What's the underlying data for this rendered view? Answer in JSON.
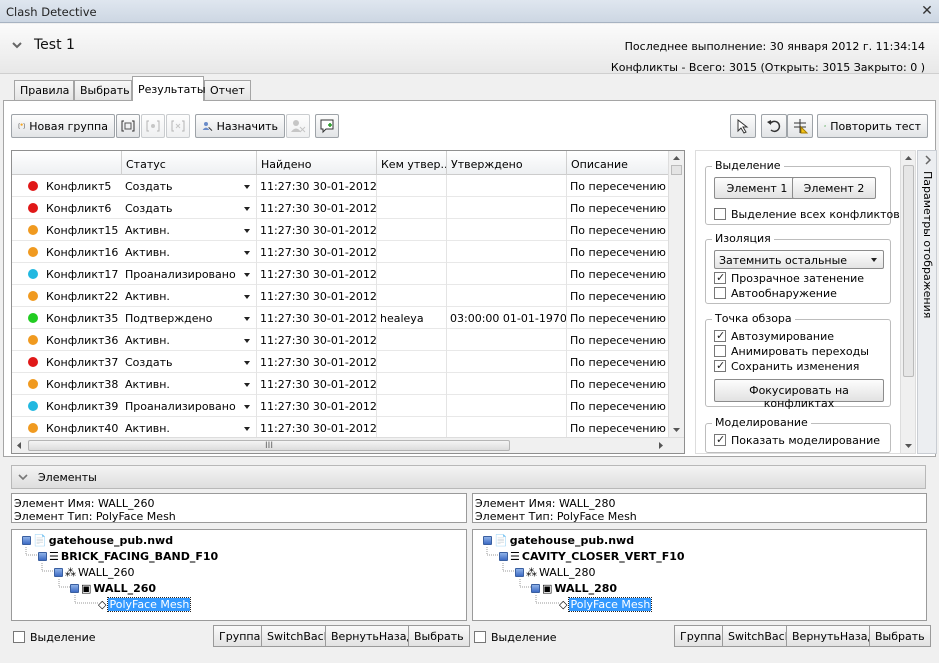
{
  "window": {
    "title": "Clash Detective"
  },
  "test": {
    "name": "Test 1",
    "last_run": "Последнее выполнение:  30 января 2012 г. 11:34:14",
    "summary": "Конфликты -  Всего:  3015  (Открыть:  3015  Закрыто:  0 )"
  },
  "tabs": [
    {
      "label": "Правила"
    },
    {
      "label": "Выбрать"
    },
    {
      "label": "Результаты"
    },
    {
      "label": "Отчет"
    }
  ],
  "toolbar": {
    "new_group": "Новая группа",
    "assign": "Назначить",
    "rerun": "Повторить тест"
  },
  "grid": {
    "columns": [
      "Статус",
      "Найдено",
      "Кем утвер...",
      "Утверждено",
      "Описание"
    ],
    "rows": [
      {
        "name": "Конфликт5",
        "color": "#e01818",
        "status": "Создать",
        "found": "11:27:30 30-01-2012",
        "by": "",
        "approved": "",
        "desc": "По пересечению"
      },
      {
        "name": "Конфликт6",
        "color": "#e01818",
        "status": "Создать",
        "found": "11:27:30 30-01-2012",
        "by": "",
        "approved": "",
        "desc": "По пересечению"
      },
      {
        "name": "Конфликт15",
        "color": "#f09a20",
        "status": "Активн.",
        "found": "11:27:30 30-01-2012",
        "by": "",
        "approved": "",
        "desc": "По пересечению"
      },
      {
        "name": "Конфликт16",
        "color": "#f09a20",
        "status": "Активн.",
        "found": "11:27:30 30-01-2012",
        "by": "",
        "approved": "",
        "desc": "По пересечению"
      },
      {
        "name": "Конфликт17",
        "color": "#22b8e0",
        "status": "Проанализировано",
        "found": "11:27:30 30-01-2012",
        "by": "",
        "approved": "",
        "desc": "По пересечению"
      },
      {
        "name": "Конфликт22",
        "color": "#f09a20",
        "status": "Активн.",
        "found": "11:27:30 30-01-2012",
        "by": "",
        "approved": "",
        "desc": "По пересечению"
      },
      {
        "name": "Конфликт35",
        "color": "#22cc22",
        "status": "Подтверждено",
        "found": "11:27:30 30-01-2012",
        "by": "healeya",
        "approved": "03:00:00 01-01-1970",
        "desc": "По пересечению"
      },
      {
        "name": "Конфликт36",
        "color": "#f09a20",
        "status": "Активн.",
        "found": "11:27:30 30-01-2012",
        "by": "",
        "approved": "",
        "desc": "По пересечению"
      },
      {
        "name": "Конфликт37",
        "color": "#e01818",
        "status": "Создать",
        "found": "11:27:30 30-01-2012",
        "by": "",
        "approved": "",
        "desc": "По пересечению"
      },
      {
        "name": "Конфликт38",
        "color": "#f09a20",
        "status": "Активн.",
        "found": "11:27:30 30-01-2012",
        "by": "",
        "approved": "",
        "desc": "По пересечению"
      },
      {
        "name": "Конфликт39",
        "color": "#22b8e0",
        "status": "Проанализировано",
        "found": "11:27:30 30-01-2012",
        "by": "",
        "approved": "",
        "desc": "По пересечению"
      },
      {
        "name": "Конфликт40",
        "color": "#f09a20",
        "status": "Активн.",
        "found": "11:27:30 30-01-2012",
        "by": "",
        "approved": "",
        "desc": "По пересечению"
      }
    ],
    "hscroll_grip": "III"
  },
  "display": {
    "selection": {
      "title": "Выделение",
      "btn1": "Элемент 1",
      "btn2": "Элемент 2",
      "select_all": "Выделение всех конфликтов"
    },
    "isolation": {
      "title": "Изоляция",
      "dropdown": "Затемнить остальные",
      "transparent": "Прозрачное затенение",
      "auto_reveal": "Автообнаружение"
    },
    "viewpoint": {
      "title": "Точка обзора",
      "auto_zoom": "Автозумирование",
      "animate": "Анимировать переходы",
      "save": "Сохранить изменения",
      "focus_btn": "Фокусировать на конфликтах"
    },
    "simulation": {
      "title": "Моделирование",
      "show": "Показать моделирование"
    },
    "side_tab": "Параметры отображения"
  },
  "elements": {
    "title": "Элементы",
    "left": {
      "name": "Элемент Имя: WALL_260",
      "type": "Элемент Тип: PolyFace Mesh",
      "tree": [
        "gatehouse_pub.nwd",
        "BRICK_FACING_BAND_F10",
        "WALL_260",
        "WALL_260",
        "PolyFace Mesh"
      ]
    },
    "right": {
      "name": "Элемент Имя: WALL_280",
      "type": "Элемент Тип: PolyFace Mesh",
      "tree": [
        "gatehouse_pub.nwd",
        "CAVITY_CLOSER_VERT_F10",
        "WALL_280",
        "WALL_280",
        "PolyFace Mesh"
      ]
    },
    "highlight": "Выделение",
    "buttons": {
      "group": "Группа",
      "switchback": "SwitchBack",
      "return": "ВернутьНазад",
      "select": "Выбрать"
    }
  }
}
